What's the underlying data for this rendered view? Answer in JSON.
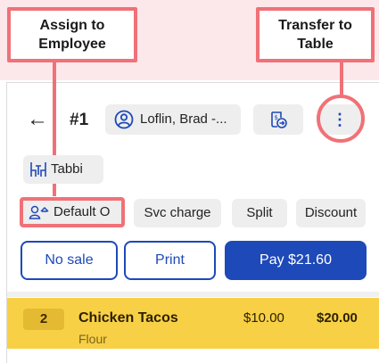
{
  "callouts": {
    "assign": {
      "line1": "Assign to",
      "line2": "Employee"
    },
    "transfer": {
      "line1": "Transfer to",
      "line2": "Table"
    }
  },
  "header": {
    "back_icon": "←",
    "order_number": "#1",
    "employee_chip": "Loflin, Brad -...",
    "more_icon": "⋮"
  },
  "table_chip": {
    "label": "Tabbi"
  },
  "actions": {
    "guest_chip": "Default O",
    "svc_charge": "Svc charge",
    "split": "Split",
    "discount": "Discount"
  },
  "buttons": {
    "no_sale": "No sale",
    "print": "Print",
    "pay": "Pay $21.60"
  },
  "items": [
    {
      "qty": "2",
      "name": "Chicken Tacos",
      "modifier": "Flour",
      "price": "$10.00",
      "total": "$20.00"
    }
  ],
  "colors": {
    "accent": "#1e49b8",
    "highlight": "#f07177",
    "selected_row": "#f8d046"
  },
  "icons": [
    "person-circle-icon",
    "card-transfer-icon",
    "more-vertical-icon",
    "table-chairs-icon",
    "guests-icon",
    "back-arrow-icon"
  ]
}
